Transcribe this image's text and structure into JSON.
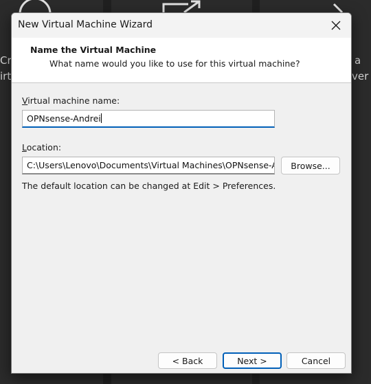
{
  "background": {
    "left_text_top": "Cr",
    "left_text_bottom": "irt",
    "right_text_top": "a",
    "right_text_bottom": "ver"
  },
  "dialog": {
    "title": "New Virtual Machine Wizard",
    "header_title": "Name the Virtual Machine",
    "header_subtitle": "What name would you like to use for this virtual machine?",
    "vm_name_label": "Virtual machine name:",
    "vm_name_value": "OPNsense-Andrei",
    "location_label": "Location:",
    "location_value": "C:\\Users\\Lenovo\\Documents\\Virtual Machines\\OPNsense-Andrei",
    "browse_label": "Browse...",
    "hint": "The default location can be changed at Edit > Preferences.",
    "back_label": "< Back",
    "next_label": "Next >",
    "cancel_label": "Cancel"
  },
  "colors": {
    "accent": "#005fb8",
    "dialog_bg": "#f0f0f0",
    "backdrop": "#202020"
  },
  "icons": [
    "close-icon",
    "globe-icon",
    "share-icon",
    "chevron-right-icon"
  ]
}
